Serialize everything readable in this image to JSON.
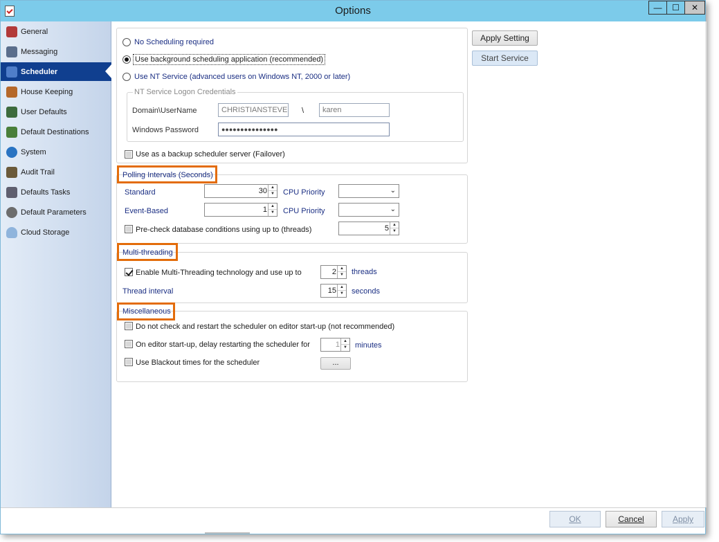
{
  "window": {
    "title": "Options",
    "min": "—",
    "max": "☐",
    "close": "✕"
  },
  "sidebar": {
    "items": [
      {
        "label": "General",
        "icon": "wrench-doc-icon",
        "color": "#b23a3a"
      },
      {
        "label": "Messaging",
        "icon": "envelope-icon",
        "color": "#5a6e8c"
      },
      {
        "label": "Scheduler",
        "icon": "calendar-icon",
        "color": "#4f7ec9",
        "active": true
      },
      {
        "label": "House Keeping",
        "icon": "broom-icon",
        "color": "#b5682a"
      },
      {
        "label": "User Defaults",
        "icon": "users-icon",
        "color": "#3d6b3d"
      },
      {
        "label": "Default Destinations",
        "icon": "destination-icon",
        "color": "#4a7f3a"
      },
      {
        "label": "System",
        "icon": "globe-icon",
        "color": "#2a74c2"
      },
      {
        "label": "Audit Trail",
        "icon": "bag-icon",
        "color": "#6b5a3a"
      },
      {
        "label": "Defaults Tasks",
        "icon": "tools-icon",
        "color": "#5f5f6f"
      },
      {
        "label": "Default Parameters",
        "icon": "question-icon",
        "color": "#6d6d6d"
      },
      {
        "label": "Cloud Storage",
        "icon": "cloud-icon",
        "color": "#8fb4dc"
      }
    ]
  },
  "scheduling": {
    "option_none": "No Scheduling required",
    "option_background": "Use background scheduling application (recommended)",
    "option_nt": "Use NT Service (advanced users on Windows NT, 2000 or later)",
    "selected": "background",
    "credentials_title": "NT Service Logon Credentials",
    "domain_label": "Domain\\UserName",
    "domain_value": "CHRISTIANSTEVEN",
    "separator": "\\",
    "username_value": "karen",
    "password_label": "Windows Password",
    "password_value": "●●●●●●●●●●●●●●●",
    "backup_label": "Use as a backup scheduler server (Failover)",
    "backup_checked": false
  },
  "actions": {
    "apply_setting": "Apply Setting",
    "start_service": "Start Service"
  },
  "polling": {
    "title": "Polling Intervals (Seconds)",
    "standard_label": "Standard",
    "standard_value": "30",
    "event_label": "Event-Based",
    "event_value": "1",
    "cpu_label": "CPU Priority",
    "cpu_standard": "",
    "cpu_event": "",
    "precheck_label": "Pre-check database conditions using up to (threads)",
    "precheck_value": "5",
    "precheck_checked": false
  },
  "multithreading": {
    "title": "Multi-threading",
    "enable_label": "Enable Multi-Threading technology and use up to",
    "enable_checked": true,
    "threads_value": "2",
    "threads_unit": "threads",
    "interval_label": "Thread interval",
    "interval_value": "15",
    "interval_unit": "seconds"
  },
  "misc": {
    "title": "Miscellaneous",
    "no_restart_label": "Do not check and restart the scheduler on editor start-up (not recommended)",
    "delay_label": "On editor start-up, delay restarting the scheduler for",
    "delay_value": "1",
    "delay_unit": "minutes",
    "blackout_label": "Use Blackout times for the scheduler",
    "blackout_button": "..."
  },
  "footer": {
    "ok": "OK",
    "cancel": "Cancel",
    "apply": "Apply"
  },
  "colors": {
    "titlebar": "#7ccbea",
    "active_nav": "#103f8f",
    "highlight": "#e36c0a",
    "section_text": "#1a2e83"
  }
}
